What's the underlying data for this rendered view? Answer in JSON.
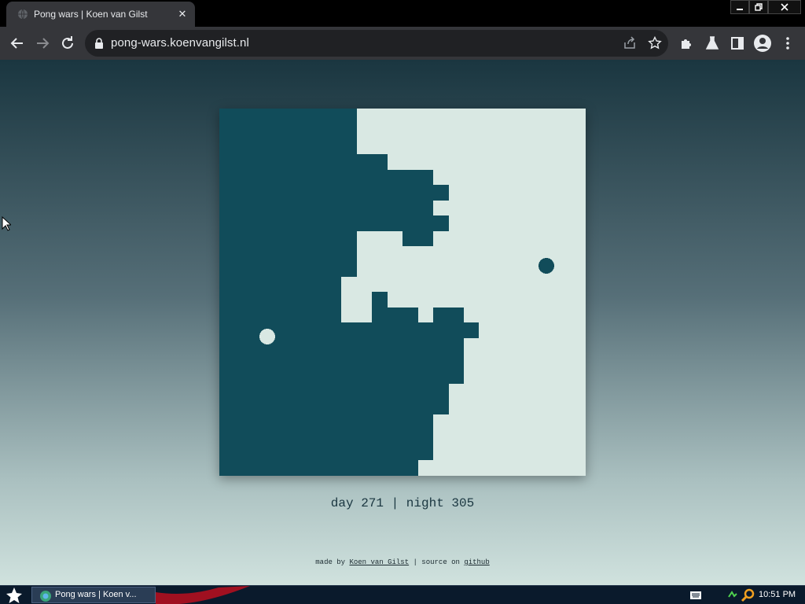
{
  "browser": {
    "tab_title": "Pong wars | Koen van Gilst",
    "tab_close": "✕",
    "url": "pong-wars.koenvangilst.nl",
    "icons": [
      "back-icon",
      "forward-icon",
      "reload-icon",
      "lock-icon",
      "share-icon",
      "star-icon",
      "extensions-icon",
      "labs-icon",
      "side-panel-icon",
      "profile-icon",
      "menu-icon"
    ]
  },
  "game": {
    "colors": {
      "day": "#D9E8E3",
      "night": "#114C5A"
    },
    "score_text": "day 271 | night 305",
    "day_score": 271,
    "night_score": 305
  },
  "footer": {
    "made_by": "made by ",
    "author": "Koen van Gilst",
    "separator": " | source on ",
    "source": "github"
  },
  "taskbar": {
    "task_label": "Pong wars | Koen v...",
    "clock": "10:51 PM"
  }
}
